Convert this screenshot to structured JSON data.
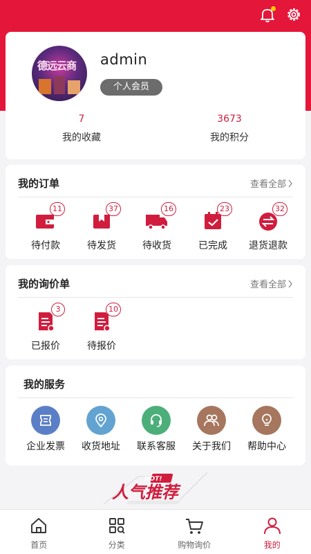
{
  "profile": {
    "avatar_text": "德远云商",
    "username": "admin",
    "member_level": "个人会员",
    "favorites": {
      "count": "7",
      "label": "我的收藏"
    },
    "points": {
      "count": "3673",
      "label": "我的积分"
    }
  },
  "orders": {
    "title": "我的订单",
    "view_all": "查看全部",
    "items": [
      {
        "label": "待付款",
        "count": "11",
        "icon": "wallet-icon"
      },
      {
        "label": "待发货",
        "count": "37",
        "icon": "package-icon"
      },
      {
        "label": "待收货",
        "count": "16",
        "icon": "truck-icon"
      },
      {
        "label": "已完成",
        "count": "23",
        "icon": "checklist-icon"
      },
      {
        "label": "退货退款",
        "count": "32",
        "icon": "exchange-icon"
      }
    ]
  },
  "inquiries": {
    "title": "我的询价单",
    "view_all": "查看全部",
    "items": [
      {
        "label": "已报价",
        "count": "3",
        "icon": "document-icon"
      },
      {
        "label": "待报价",
        "count": "10",
        "icon": "document-icon"
      }
    ]
  },
  "services": {
    "title": "我的服务",
    "items": [
      {
        "label": "企业发票",
        "icon": "invoice-icon",
        "color": "#5b7fc7"
      },
      {
        "label": "收货地址",
        "icon": "location-pin-icon",
        "color": "#62a3d1"
      },
      {
        "label": "联系客服",
        "icon": "headset-icon",
        "color": "#4caf7a"
      },
      {
        "label": "关于我们",
        "icon": "people-icon",
        "color": "#a6765e"
      },
      {
        "label": "帮助中心",
        "icon": "lightbulb-icon",
        "color": "#a6765e"
      }
    ]
  },
  "banner": {
    "tag": "HOT!",
    "text": "人气推荐"
  },
  "tabbar": {
    "items": [
      {
        "label": "首页",
        "icon": "home-icon"
      },
      {
        "label": "分类",
        "icon": "category-icon"
      },
      {
        "label": "购物询价",
        "icon": "cart-icon"
      },
      {
        "label": "我的",
        "icon": "user-icon"
      }
    ],
    "active": "我的"
  },
  "colors": {
    "accent": "#e4163a",
    "text_red": "#d01d3e"
  }
}
